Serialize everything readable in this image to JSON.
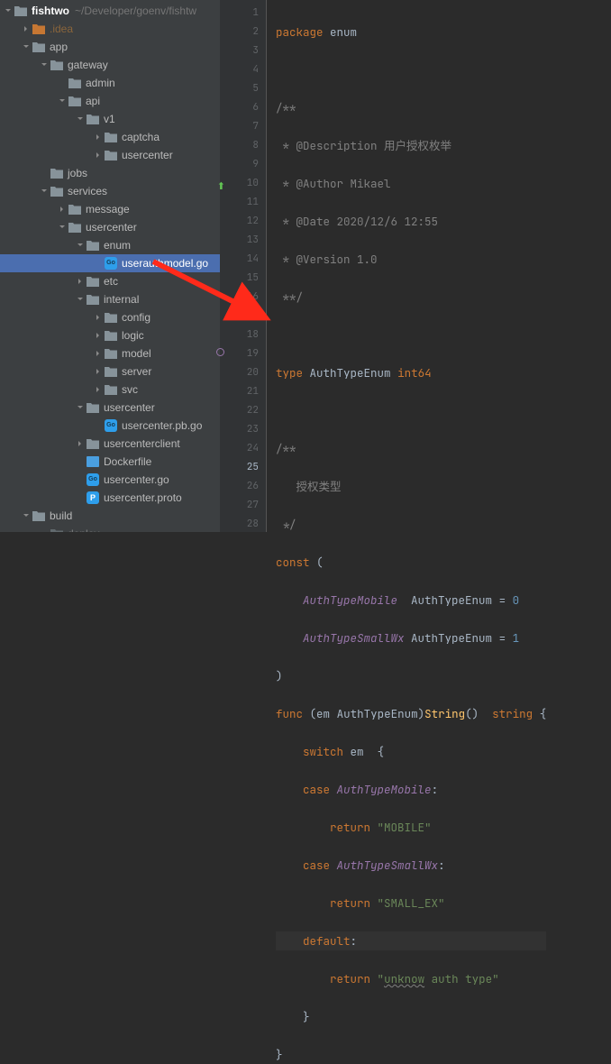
{
  "project": {
    "name": "fishtwo",
    "path": "~/Developer/goenv/fishtw"
  },
  "tree": {
    "idea": ".idea",
    "app": "app",
    "gateway": "gateway",
    "admin": "admin",
    "api": "api",
    "v1": "v1",
    "captcha": "captcha",
    "usercenter_v1": "usercenter",
    "jobs": "jobs",
    "services": "services",
    "message": "message",
    "usercenter": "usercenter",
    "enum": "enum",
    "userauthmodel": "userauthmodel.go",
    "etc": "etc",
    "internal": "internal",
    "config": "config",
    "logic": "logic",
    "model": "model",
    "server": "server",
    "svc": "svc",
    "usercenter_dir": "usercenter",
    "usercenter_pb": "usercenter.pb.go",
    "usercenterclient": "usercenterclient",
    "dockerfile": "Dockerfile",
    "usercenter_go": "usercenter.go",
    "usercenter_proto": "usercenter.proto",
    "build": "build",
    "deploy": "deploy"
  },
  "code": {
    "l1": "package enum",
    "l3": "/**",
    "l4": " * @Description 用户授权枚举",
    "l5": " * @Author Mikael",
    "l6": " * @Date 2020/12/6 12:55",
    "l7": " * @Version 1.0",
    "l8": " **/",
    "l10_type": "type",
    "l10_name": "AuthTypeEnum",
    "l10_int64": "int64",
    "l12": "/**",
    "l13": "   授权类型",
    "l14": " */",
    "l15_const": "const",
    "l16_a": "AuthTypeMobile",
    "l16_b": "AuthTypeEnum",
    "l16_eq": "=",
    "l16_v": "0",
    "l17_a": "AuthTypeSmallWx",
    "l17_b": "AuthTypeEnum",
    "l17_eq": "=",
    "l17_v": "1",
    "l19_func": "func",
    "l19_em": "em",
    "l19_type": "AuthTypeEnum",
    "l19_String": "String",
    "l19_ret": "string",
    "l20_switch": "switch",
    "l20_em": "em",
    "l21_case": "case",
    "l21_v": "AuthTypeMobile",
    "l22_return": "return",
    "l22_v": "\"MOBILE\"",
    "l23_case": "case",
    "l23_v": "AuthTypeSmallWx",
    "l24_return": "return",
    "l24_v": "\"SMALL_EX\"",
    "l25_default": "default",
    "l26_return": "return",
    "l26_a": "\"",
    "l26_b": "unknow",
    "l26_c": " auth type\""
  },
  "lines": [
    "1",
    "2",
    "3",
    "4",
    "5",
    "6",
    "7",
    "8",
    "9",
    "10",
    "11",
    "12",
    "13",
    "14",
    "15",
    "16",
    "17",
    "18",
    "19",
    "20",
    "21",
    "22",
    "23",
    "24",
    "25",
    "26",
    "27",
    "28"
  ]
}
